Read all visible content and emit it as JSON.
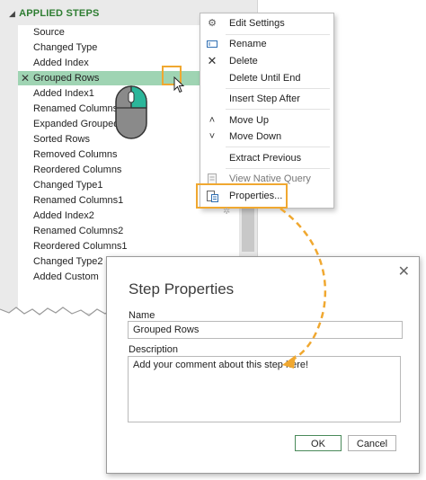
{
  "steps_panel": {
    "header": "APPLIED STEPS",
    "steps": [
      {
        "label": "Source"
      },
      {
        "label": "Changed Type"
      },
      {
        "label": "Added Index"
      },
      {
        "label": "Grouped Rows",
        "selected": true
      },
      {
        "label": "Added Index1"
      },
      {
        "label": "Renamed Columns"
      },
      {
        "label": "Expanded Grouped D"
      },
      {
        "label": "Sorted Rows"
      },
      {
        "label": "Removed Columns"
      },
      {
        "label": "Reordered Columns"
      },
      {
        "label": "Changed Type1"
      },
      {
        "label": "Renamed Columns1"
      },
      {
        "label": "Added Index2"
      },
      {
        "label": "Renamed Columns2"
      },
      {
        "label": "Reordered Columns1"
      },
      {
        "label": "Changed Type2"
      },
      {
        "label": "Added Custom"
      }
    ]
  },
  "context_menu": {
    "items": [
      {
        "label": "Edit Settings",
        "icon": "gear-icon"
      },
      {
        "label": "Rename",
        "icon": "rename-icon"
      },
      {
        "label": "Delete",
        "icon": "delete-x-icon"
      },
      {
        "label": "Delete Until End",
        "icon": ""
      },
      {
        "label": "Insert Step After",
        "icon": ""
      },
      {
        "label": "Move Up",
        "icon": "chevron-up-icon"
      },
      {
        "label": "Move Down",
        "icon": "chevron-down-icon"
      },
      {
        "label": "Extract Previous",
        "icon": ""
      },
      {
        "label": "View Native Query",
        "icon": "native-query-icon",
        "disabled": true
      },
      {
        "label": "Properties...",
        "icon": "properties-icon"
      }
    ]
  },
  "dialog": {
    "title": "Step Properties",
    "name_label": "Name",
    "name_value": "Grouped Rows",
    "description_label": "Description",
    "description_value": "Add your comment about this step here!",
    "ok_label": "OK",
    "cancel_label": "Cancel"
  },
  "colors": {
    "highlight_orange": "#f0a830",
    "selected_row_green": "#9fd4b3",
    "header_green": "#2e7d32",
    "mouse_button_teal": "#2bb69a"
  }
}
